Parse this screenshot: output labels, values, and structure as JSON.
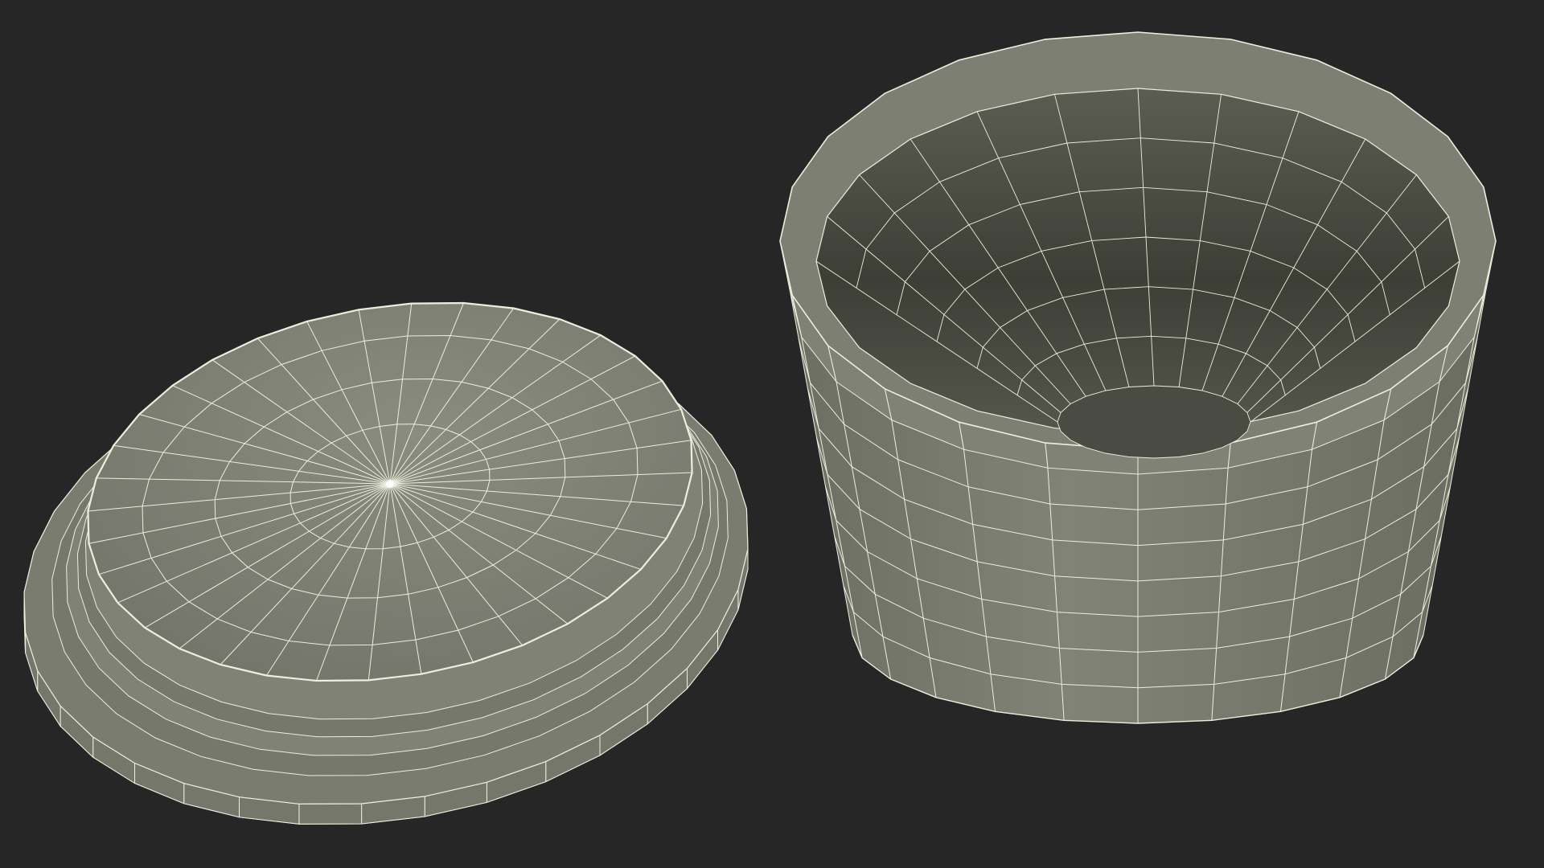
{
  "scene": {
    "background_color": "#262626",
    "objects": [
      {
        "name": "lid",
        "description_icon": "cylinder-lid-icon",
        "surface_color": "#7b7d6f",
        "wire_color": "#eeeedd",
        "radial_segments": 36
      },
      {
        "name": "cup",
        "description_icon": "cup-icon",
        "surface_color": "#7b7d6f",
        "wire_color": "#eeeedd",
        "radial_segments": 24
      }
    ]
  }
}
